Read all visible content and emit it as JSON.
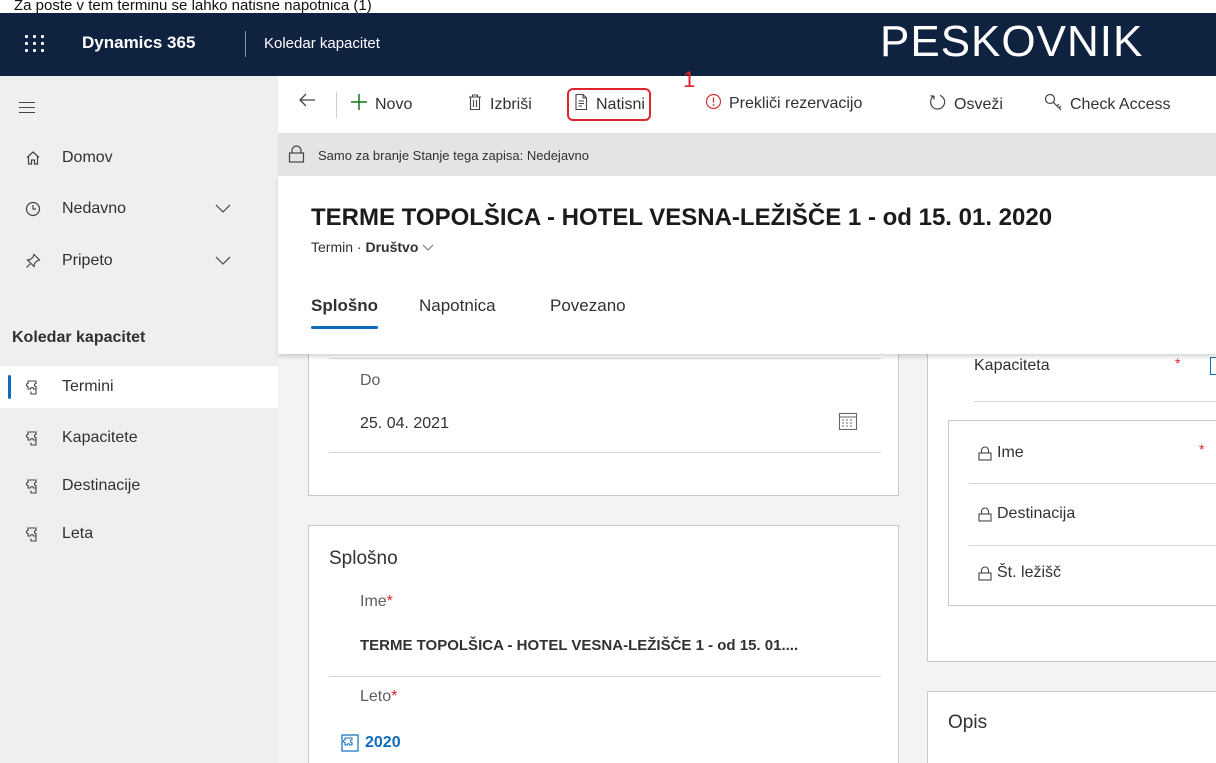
{
  "caption": "Za poste v tem terminu se lahko natisne napotnica (1)",
  "topbar": {
    "brand": "Dynamics 365",
    "app_name": "Koledar kapacitet",
    "environment": "PESKOVNIK",
    "background": "#0f2240"
  },
  "sidebar": {
    "items": [
      {
        "label": "Domov",
        "icon": "home-icon"
      },
      {
        "label": "Nedavno",
        "icon": "clock-icon",
        "chevron": "∨"
      },
      {
        "label": "Pripeto",
        "icon": "pin-icon",
        "chevron": "∨"
      }
    ],
    "section_title": "Koledar kapacitet",
    "entities": [
      {
        "label": "Termini",
        "icon": "puzzle-icon",
        "active": true
      },
      {
        "label": "Kapacitete",
        "icon": "puzzle-icon"
      },
      {
        "label": "Destinacije",
        "icon": "puzzle-icon"
      },
      {
        "label": "Leta",
        "icon": "puzzle-icon"
      }
    ]
  },
  "commands": {
    "new": "Novo",
    "delete": "Izbriši",
    "print": "Natisni",
    "cancel_reservation": "Prekliči rezervacijo",
    "refresh": "Osveži",
    "check_access": "Check Access",
    "callout_number": "1"
  },
  "readonly_banner": "Samo za branje Stanje tega zapisa: Nedejavno",
  "record": {
    "title": "TERME TOPOLŠICA - HOTEL VESNA-LEŽIŠČE 1 - od 15. 01. 2020",
    "entity": "Termin",
    "form_name": "Društvo"
  },
  "tabs": [
    "Splošno",
    "Napotnica",
    "Povezano"
  ],
  "form": {
    "do_label": "Do",
    "do_value": "25. 04. 2021",
    "general_section_title": "Splošno",
    "name_label": "Ime",
    "name_value": "TERME TOPOLŠICA - HOTEL VESNA-LEŽIŠČE 1 - od 15. 01....",
    "year_label": "Leto",
    "year_value": "2020",
    "capacity_label": "Kapaciteta",
    "capacity_fields": {
      "name": "Ime",
      "destination": "Destinacija",
      "beds": "Št. ležišč"
    },
    "description_title": "Opis",
    "required_marker": "*"
  },
  "colors": {
    "accent": "#0f6cbd",
    "highlight": "#e0242b",
    "sidebar_bg": "#efefef"
  }
}
